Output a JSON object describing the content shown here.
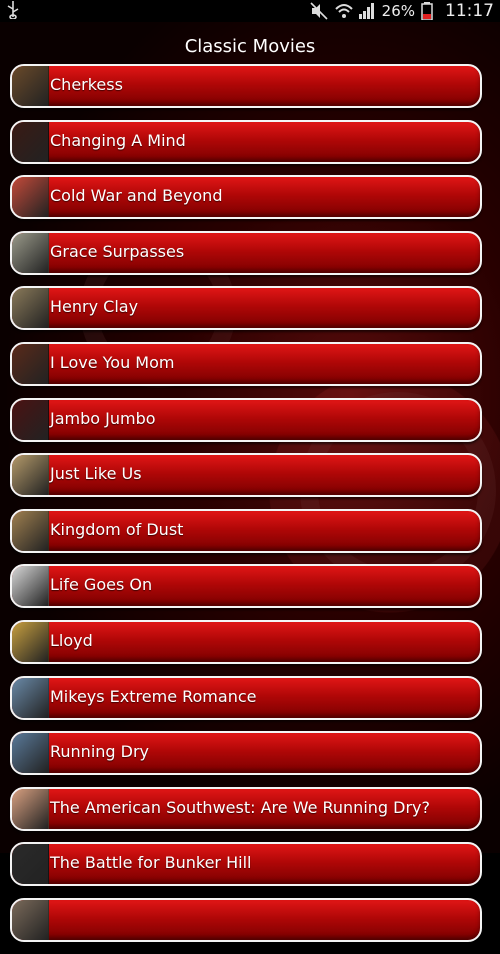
{
  "status_bar": {
    "battery_percent": "26%",
    "time": "11:17",
    "icons": [
      "usb-icon",
      "mute-icon",
      "wifi-icon",
      "signal-icon",
      "battery-icon",
      "alert-icon"
    ]
  },
  "title": "Classic Movies",
  "movies": [
    {
      "label": "Cherkess",
      "thumb_color": "#6a4a2a"
    },
    {
      "label": "Changing A Mind",
      "thumb_color": "#3a1a14"
    },
    {
      "label": "Cold War and Beyond",
      "thumb_color": "#c44a3a"
    },
    {
      "label": "Grace Surpasses",
      "thumb_color": "#9a9a8a"
    },
    {
      "label": "Henry Clay",
      "thumb_color": "#8a7a5a"
    },
    {
      "label": "I Love You Mom",
      "thumb_color": "#5a2a1a"
    },
    {
      "label": "Jambo Jumbo",
      "thumb_color": "#4a1212"
    },
    {
      "label": "Just Like Us",
      "thumb_color": "#b49a6a"
    },
    {
      "label": "Kingdom of Dust",
      "thumb_color": "#a08050"
    },
    {
      "label": "Life Goes On",
      "thumb_color": "#d8d8d8"
    },
    {
      "label": "Lloyd",
      "thumb_color": "#c8a040"
    },
    {
      "label": "Mikeys Extreme Romance",
      "thumb_color": "#6a8aa8"
    },
    {
      "label": "Running Dry",
      "thumb_color": "#5a7a9a"
    },
    {
      "label": "The American Southwest: Are We Running Dry?",
      "thumb_color": "#d8a080"
    },
    {
      "label": "The Battle for Bunker Hill",
      "thumb_color": "#2a2a2a"
    },
    {
      "label": "",
      "thumb_color": "#7a6a5a"
    }
  ]
}
